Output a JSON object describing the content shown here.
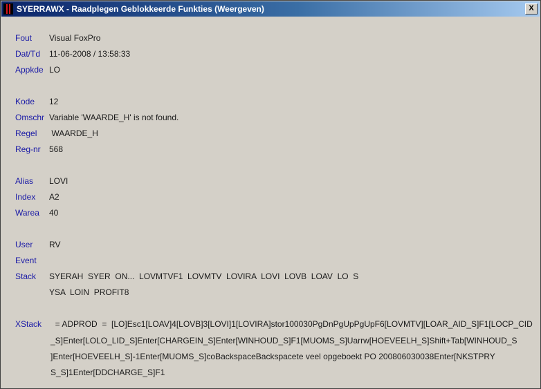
{
  "window": {
    "title": "SYERRAWX - Raadplegen Geblokkeerde Funkties (Weergeven)",
    "close_glyph": "X",
    "icon": "app-icon"
  },
  "fields": {
    "fout": {
      "label": "Fout",
      "value": "Visual FoxPro"
    },
    "dattd": {
      "label": "Dat/Td",
      "value": "11-06-2008 / 13:58:33"
    },
    "appkde": {
      "label": "Appkde",
      "value": "LO"
    },
    "kode": {
      "label": "Kode",
      "value": "12"
    },
    "omschr": {
      "label": "Omschr",
      "value": "Variable 'WAARDE_H' is not found."
    },
    "regel": {
      "label": "Regel",
      "value": " WAARDE_H"
    },
    "regnr": {
      "label": "Reg-nr",
      "value": "568"
    },
    "alias": {
      "label": "Alias",
      "value": "LOVI"
    },
    "index": {
      "label": "Index",
      "value": "A2"
    },
    "warea": {
      "label": "Warea",
      "value": "40"
    },
    "user": {
      "label": "User",
      "value": "RV"
    },
    "event": {
      "label": "Event",
      "value": ""
    },
    "stack": {
      "label": "Stack",
      "lines": [
        "SYERAH  SYER  ON...  LOVMTVF1  LOVMTV  LOVIRA  LOVI  LOVB  LOAV  LO  S",
        "YSA  LOIN  PROFIT8"
      ]
    },
    "xstack": {
      "label": "XStack",
      "lines": [
        "  = ADPROD  =  [LO]Esc1[LOAV]4[LOVB]3[LOVI]1[LOVIRA]stor100030PgDnPgUpPgUpF6[LOVMTV][LOAR_AID_S]F1[LOCP_CID",
        "_S]Enter[LOLO_LID_S]Enter[CHARGEIN_S]Enter[WINHOUD_S]F1[MUOMS_S]Uarrw[HOEVEELH_S]Shift+Tab[WINHOUD_S",
        "]Enter[HOEVEELH_S]-1Enter[MUOMS_S]coBackspaceBackspacete veel opgeboekt PO 200806030038Enter[NKSTPRY",
        "S_S]1Enter[DDCHARGE_S]F1"
      ]
    }
  }
}
